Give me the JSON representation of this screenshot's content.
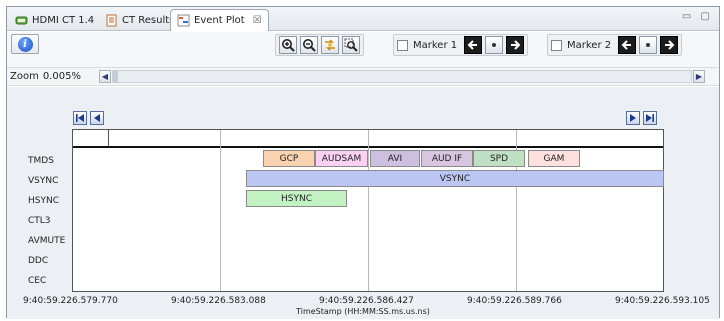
{
  "tabs": [
    {
      "label": "HDMI CT 1.4",
      "icon": "hdmi-icon",
      "active": false
    },
    {
      "label": "CT Results",
      "icon": "document-icon",
      "active": false
    },
    {
      "label": "Event Plot",
      "icon": "plot-icon",
      "active": true,
      "close": "☒"
    }
  ],
  "window_controls": "▭ ▢",
  "toolbar": {
    "info_glyph": "i",
    "zoom_buttons": [
      {
        "name": "zoom-in-button",
        "glyph": "⊕",
        "icon": "zoom-in-icon"
      },
      {
        "name": "zoom-out-button",
        "glyph": "⊖",
        "icon": "zoom-out-icon"
      },
      {
        "name": "zoom-reset-button",
        "glyph": "↯",
        "icon": "zoom-reset-icon"
      },
      {
        "name": "zoom-fit-button",
        "glyph": "🔍",
        "icon": "zoom-fit-icon"
      }
    ],
    "marker1": {
      "label": "Marker 1",
      "checked": false
    },
    "marker2": {
      "label": "Marker 2",
      "checked": false
    },
    "marker_prev_glyph": "⮜",
    "marker_next_glyph": "⮞"
  },
  "zoom": {
    "label": "Zoom",
    "value": "0.005%",
    "left_glyph": "◀",
    "right_glyph": "▶"
  },
  "nav": {
    "first": "⏮",
    "prev": "◀",
    "next": "▶",
    "last": "⏭"
  },
  "rows": [
    "TMDS",
    "VSYNC",
    "HSYNC",
    "CTL3",
    "AVMUTE",
    "DDC",
    "CEC"
  ],
  "events": {
    "tmds": [
      {
        "label": "GCP",
        "color": "#fad2b0"
      },
      {
        "label": "AUDSAM",
        "color": "#fbd1f3"
      },
      {
        "label": "AVI",
        "color": "#cdbfe0"
      },
      {
        "label": "AUD IF",
        "color": "#d8c6e0"
      },
      {
        "label": "SPD",
        "color": "#bfe0c3"
      },
      {
        "label": "GAM",
        "color": "#fde1df"
      }
    ],
    "vsync": {
      "label": "VSYNC",
      "color": "#bcc6f2"
    },
    "hsync": {
      "label": "HSYNC",
      "color": "#c2f2c1"
    }
  },
  "timestamps": [
    "9:40:59.226.579.770",
    "9:40:59.226.583.088",
    "9:40:59.226.586.427",
    "9:40:59.226.589.766",
    "9:40:59.226.593.105"
  ],
  "axis_title": "TimeStamp (HH:MM:SS.ms.us.ns)"
}
